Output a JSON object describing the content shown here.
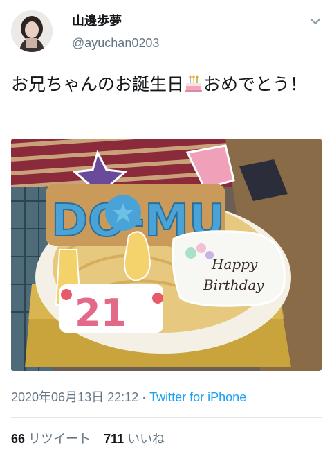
{
  "user": {
    "display_name": "山邊歩夢",
    "handle": "@ayuchan0203"
  },
  "tweet": {
    "text_before": "お兄ちゃんのお誕生日",
    "emoji": "birthday-cake-emoji",
    "text_after": "おめでとう！"
  },
  "media": {
    "cookie_letters": "DO-MU",
    "cookie_numbers": "21",
    "plaque_line1": "Happy",
    "plaque_line2": "Birthday"
  },
  "meta": {
    "timestamp": "2020年06月13日 22:12",
    "separator": " · ",
    "client": "Twitter for iPhone"
  },
  "stats": {
    "retweet_count": "66",
    "retweet_label": "リツイート",
    "like_count": "711",
    "like_label": "いいね"
  }
}
